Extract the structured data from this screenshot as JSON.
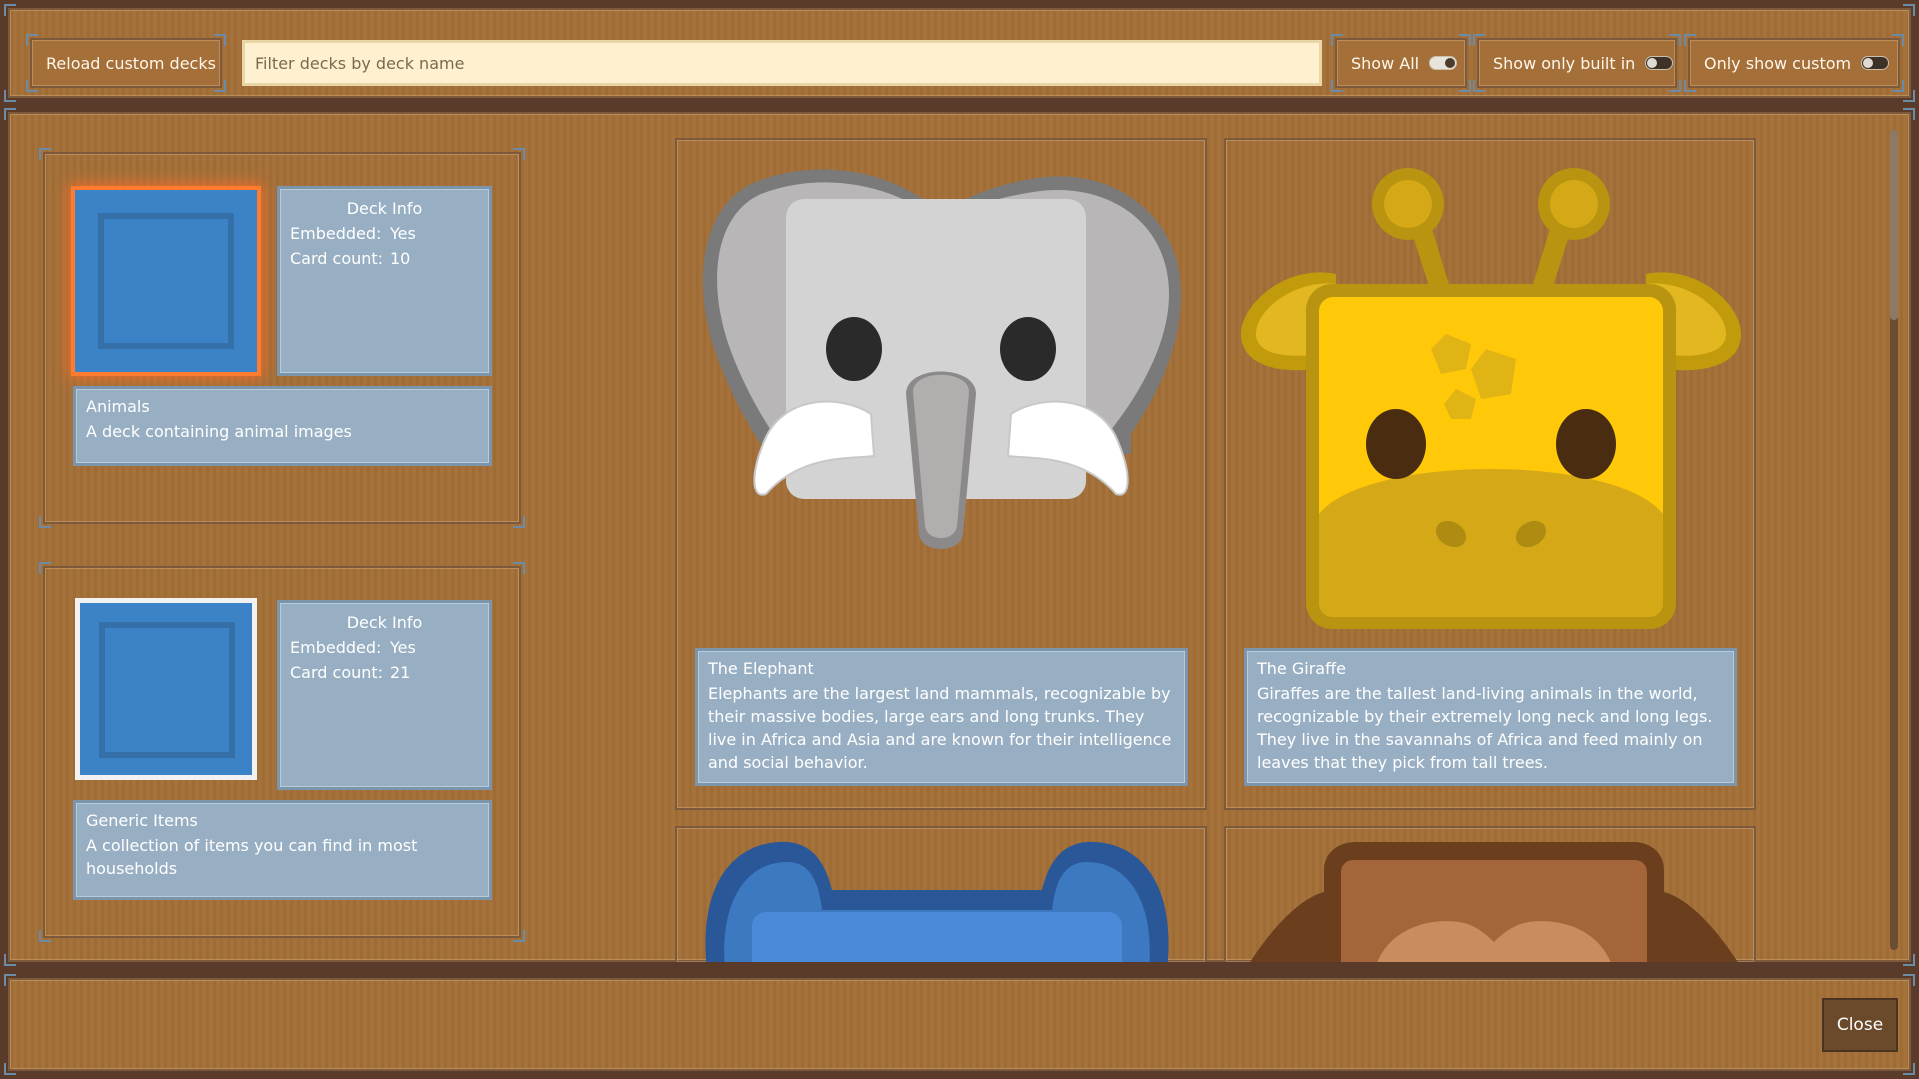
{
  "toolbar": {
    "reload_label": "Reload custom decks",
    "search_placeholder": "Filter decks by deck name",
    "show_all_label": "Show All",
    "show_all_on": true,
    "show_builtin_label": "Show only built in",
    "show_builtin_on": false,
    "show_custom_label": "Only show custom",
    "show_custom_on": false
  },
  "decks": [
    {
      "info_title": "Deck Info",
      "embedded_key": "Embedded:",
      "embedded_value": "Yes",
      "count_key": "Card count:",
      "count_value": "10",
      "name": "Animals",
      "description": "A deck containing animal images",
      "selected": true
    },
    {
      "info_title": "Deck Info",
      "embedded_key": "Embedded:",
      "embedded_value": "Yes",
      "count_key": "Card count:",
      "count_value": "21",
      "name": "Generic Items",
      "description": "A collection of items you can find in most households",
      "selected": false
    }
  ],
  "cards": [
    {
      "icon": "elephant-icon",
      "title": "The Elephant",
      "text": "Elephants are the largest land mammals, recognizable by their massive bodies, large ears and long trunks. They live in Africa and Asia and are known for their intelligence and social behavior."
    },
    {
      "icon": "giraffe-icon",
      "title": "The Giraffe",
      "text": "Giraffes are the tallest land-living animals in the world, recognizable by their extremely long neck and long legs. They live in the savannahs of Africa and feed mainly on leaves that they pick from tall trees."
    },
    {
      "icon": "hippo-icon"
    },
    {
      "icon": "monkey-icon"
    }
  ],
  "footer": {
    "close_label": "Close"
  },
  "colors": {
    "wood": "#a46f38",
    "panel": "#98afc3",
    "accent_selected": "#ff7b2e",
    "search_bg": "#fff1cf"
  }
}
